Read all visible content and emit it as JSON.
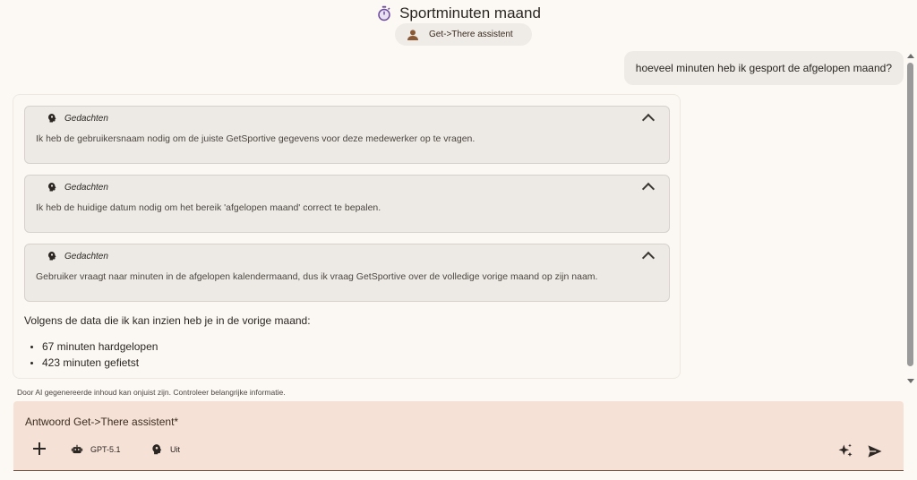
{
  "header": {
    "title": "Sportminuten maand",
    "agent_chip": "Get->There assistent"
  },
  "user_message": "hoeveel minuten heb ik gesport de afgelopen maand?",
  "thoughts": [
    {
      "title": "Gedachten",
      "body": "Ik heb de gebruikersnaam nodig om de juiste GetSportive gegevens voor deze medewerker op te vragen."
    },
    {
      "title": "Gedachten",
      "body": "Ik heb de huidige datum nodig om het bereik 'afgelopen maand' correct te bepalen."
    },
    {
      "title": "Gedachten",
      "body": "Gebruiker vraagt naar minuten in de afgelopen kalendermaand, dus ik vraag GetSportive over de volledige vorige maand op zijn naam."
    }
  ],
  "answer": {
    "intro": "Volgens de data die ik kan inzien heb je in de vorige maand:",
    "items": [
      "67 minuten hardgelopen",
      "423 minuten gefietst"
    ]
  },
  "disclaimer": "Door AI gegenereerde inhoud kan onjuist zijn. Controleer belangrijke informatie.",
  "composer": {
    "placeholder": "Antwoord Get->There assistent*",
    "model": "GPT-5.1",
    "reasoning": "Uit"
  },
  "icons": {
    "title": "stopwatch-icon",
    "agent": "person-icon",
    "thought": "brain-icon",
    "collapse": "chevron-up-icon",
    "add": "plus-icon",
    "model": "robot-icon",
    "reasoning": "brain-icon",
    "enhance": "sparkle-icon",
    "send": "send-icon"
  },
  "colors": {
    "background": "#fcf8f4",
    "composer": "#f6e1d6",
    "accent_brown": "#6d4d3e"
  }
}
